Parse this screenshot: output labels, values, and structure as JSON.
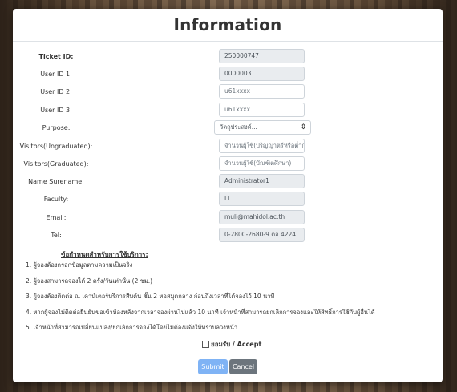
{
  "modal": {
    "title": "Information"
  },
  "form": {
    "fields": [
      {
        "label": "Ticket ID:",
        "value": "250000747",
        "readonly": true,
        "placeholder": ""
      },
      {
        "label": "User ID 1:",
        "value": "0000003",
        "readonly": true,
        "placeholder": ""
      },
      {
        "label": "User ID 2:",
        "value": "",
        "readonly": false,
        "placeholder": "u61xxxx"
      },
      {
        "label": "User ID 3:",
        "value": "",
        "readonly": false,
        "placeholder": "u61xxxx"
      },
      {
        "label": "Purpose:",
        "selected": "วัตถุประสงค์..."
      },
      {
        "label": "Visitors(Ungraduated):",
        "value": "",
        "readonly": false,
        "placeholder": "จำนวนผู้ใช้(ปริญญาตรีหรือต่ำกว่า)"
      },
      {
        "label": "Visitors(Graduated):",
        "value": "",
        "readonly": false,
        "placeholder": "จำนวนผู้ใช้(บัณฑิตศึกษา)"
      },
      {
        "label": "Name Surename:",
        "value": "Administrator1",
        "readonly": true,
        "placeholder": ""
      },
      {
        "label": "Faculty:",
        "value": "LI",
        "readonly": true,
        "placeholder": ""
      },
      {
        "label": "Email:",
        "value": "muli@mahidol.ac.th",
        "readonly": true,
        "placeholder": ""
      },
      {
        "label": "Tel:",
        "value": "0-2800-2680-9 ต่อ 4224",
        "readonly": true,
        "placeholder": ""
      }
    ]
  },
  "terms": {
    "title": "ข้อกำหนดสำหรับการใช้บริการ:",
    "items": [
      "1. ผู้จองต้องกรอกข้อมูลตามความเป็นจริง",
      "2. ผู้จองสามารถจองได้ 2 ครั้ง/วันเท่านั้น (2 ชม.)",
      "3. ผู้จองต้องติดต่อ ณ เคาน์เตอร์บริการสืบค้น ชั้น 2 หอสมุดกลาง ก่อนถึงเวลาที่ได้จองไว้ 10 นาที",
      "4. หากผู้จองไม่ติดต่อยืนยันขอเข้าห้องหลังจากเวลาจองผ่านไปแล้ว 10 นาที เจ้าหน้าที่สามารถยกเลิกการจองและให้สิทธิ์การใช้กับผู้อื่นได้",
      "5. เจ้าหน้าที่สามารถเปลี่ยนแปลง/ยกเลิกการจองได้โดยไม่ต้องแจ้งให้ทราบล่วงหน้า"
    ],
    "accept_label": "ยอมรับ / Accept"
  },
  "buttons": {
    "submit": "Submit",
    "cancel": "Cancel"
  },
  "colors": {
    "submit": "#7fb3f5",
    "cancel": "#6c757d",
    "readonly_bg": "#e9ecef"
  },
  "icons": {
    "purpose_caret": "chevron-updown-icon"
  }
}
